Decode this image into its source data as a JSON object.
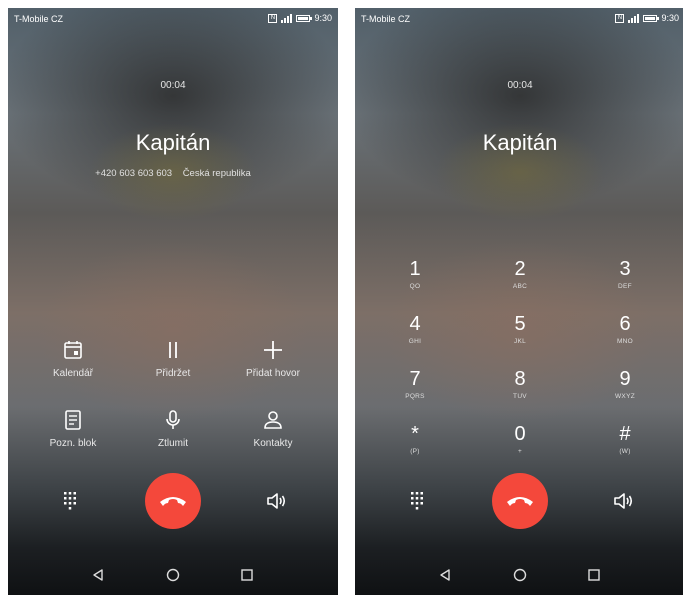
{
  "left_screen": {
    "status": {
      "carrier": "T-Mobile CZ",
      "nfc": "N",
      "time": "9:30"
    },
    "call_timer": "00:04",
    "contact": {
      "name": "Kapitán",
      "number": "+420 603 603 603",
      "country": "Česká republika"
    },
    "actions": [
      {
        "label": "Kalendář",
        "icon": "calendar-icon"
      },
      {
        "label": "Přidržet",
        "icon": "pause-icon"
      },
      {
        "label": "Přidat hovor",
        "icon": "plus-icon"
      },
      {
        "label": "Pozn. blok",
        "icon": "notepad-icon"
      },
      {
        "label": "Ztlumit",
        "icon": "microphone-icon"
      },
      {
        "label": "Kontakty",
        "icon": "person-icon"
      }
    ]
  },
  "right_screen": {
    "status": {
      "carrier": "T-Mobile CZ",
      "nfc": "N",
      "time": "9:30"
    },
    "call_timer": "00:04",
    "contact": {
      "name": "Kapitán"
    },
    "keypad": [
      {
        "digit": "1",
        "letters": "QO"
      },
      {
        "digit": "2",
        "letters": "ABC"
      },
      {
        "digit": "3",
        "letters": "DEF"
      },
      {
        "digit": "4",
        "letters": "GHI"
      },
      {
        "digit": "5",
        "letters": "JKL"
      },
      {
        "digit": "6",
        "letters": "MNO"
      },
      {
        "digit": "7",
        "letters": "PQRS"
      },
      {
        "digit": "8",
        "letters": "TUV"
      },
      {
        "digit": "9",
        "letters": "WXYZ"
      },
      {
        "digit": "*",
        "letters": "(P)"
      },
      {
        "digit": "0",
        "letters": "+"
      },
      {
        "digit": "#",
        "letters": "(W)"
      }
    ]
  },
  "colors": {
    "hangup": "#f4483b"
  },
  "icons": {
    "dialpad": "dialpad-icon",
    "speaker": "speaker-icon",
    "hangup": "hangup-icon",
    "nav": [
      "back-icon",
      "home-icon",
      "recent-apps-icon"
    ]
  }
}
